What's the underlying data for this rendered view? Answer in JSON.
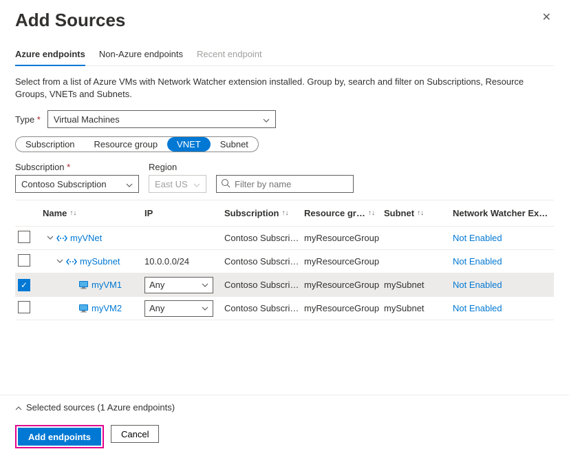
{
  "header": {
    "title": "Add Sources"
  },
  "tabs": {
    "t0": "Azure endpoints",
    "t1": "Non-Azure endpoints",
    "t2": "Recent endpoint"
  },
  "description": "Select from a list of Azure VMs with Network Watcher extension installed. Group by, search and filter on Subscriptions, Resource Groups, VNETs and Subnets.",
  "type_field": {
    "label": "Type",
    "value": "Virtual Machines"
  },
  "groupby": {
    "g0": "Subscription",
    "g1": "Resource group",
    "g2": "VNET",
    "g3": "Subnet"
  },
  "filters": {
    "subscription_label": "Subscription",
    "subscription_value": "Contoso Subscription",
    "region_label": "Region",
    "region_value": "East US",
    "search_placeholder": "Filter by name"
  },
  "columns": {
    "name": "Name",
    "ip": "IP",
    "subscription": "Subscription",
    "rg": "Resource gr…",
    "subnet": "Subnet",
    "nw": "Network Watcher Ex…"
  },
  "rows": [
    {
      "checked": false,
      "indent": 1,
      "kind": "vnet",
      "chev": true,
      "name": "myVNet",
      "ip": "",
      "ip_dd": false,
      "sub": "Contoso Subscri…",
      "rg": "myResourceGroup",
      "subnet": "",
      "nw": "Not Enabled"
    },
    {
      "checked": false,
      "indent": 2,
      "kind": "subnet",
      "chev": true,
      "name": "mySubnet",
      "ip": "10.0.0.0/24",
      "ip_dd": false,
      "sub": "Contoso Subscri…",
      "rg": "myResourceGroup",
      "subnet": "",
      "nw": "Not Enabled"
    },
    {
      "checked": true,
      "indent": 3,
      "kind": "vm",
      "chev": false,
      "name": "myVM1",
      "ip": "Any",
      "ip_dd": true,
      "sub": "Contoso Subscri…",
      "rg": "myResourceGroup",
      "subnet": "mySubnet",
      "nw": "Not Enabled"
    },
    {
      "checked": false,
      "indent": 3,
      "kind": "vm",
      "chev": false,
      "name": "myVM2",
      "ip": "Any",
      "ip_dd": true,
      "sub": "Contoso Subscri…",
      "rg": "myResourceGroup",
      "subnet": "mySubnet",
      "nw": "Not Enabled"
    }
  ],
  "summary": "Selected sources (1 Azure endpoints)",
  "buttons": {
    "primary": "Add endpoints",
    "secondary": "Cancel"
  }
}
